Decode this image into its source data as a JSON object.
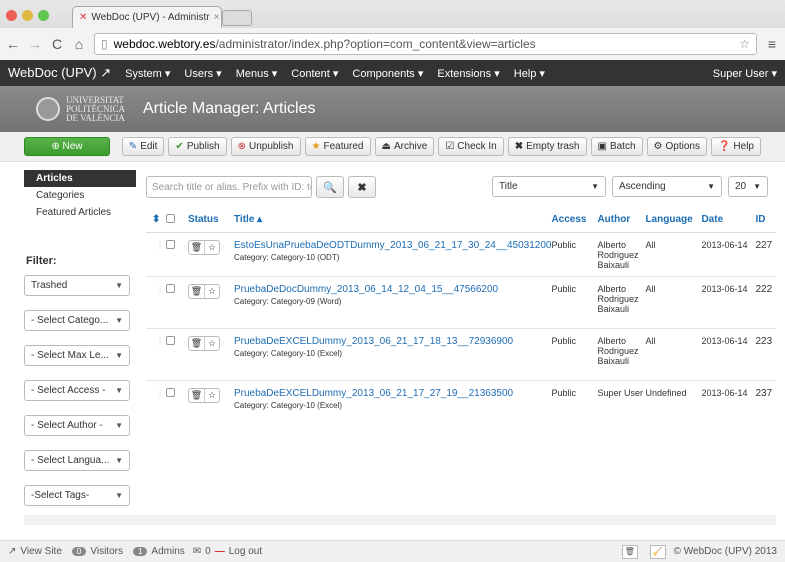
{
  "browser": {
    "tab_title": "WebDoc (UPV) - Administr",
    "url_host": "webdoc.webtory.es",
    "url_path": "/administrator/index.php?option=com_content&view=articles"
  },
  "menubar": {
    "brand": "WebDoc (UPV) ↗",
    "items": [
      "System ▾",
      "Users ▾",
      "Menus ▾",
      "Content ▾",
      "Components ▾",
      "Extensions ▾",
      "Help ▾"
    ],
    "user": "Super User ▾"
  },
  "header": {
    "logo_lines": [
      "UNIVERSITAT",
      "POLITÈCNICA",
      "DE VALÈNCIA"
    ],
    "title": "Article Manager: Articles"
  },
  "toolbar": {
    "new": "⊕ New",
    "edit": "Edit",
    "publish": "Publish",
    "unpublish": "Unpublish",
    "featured": "Featured",
    "archive": "Archive",
    "checkin": "Check In",
    "empty_trash": "Empty trash",
    "batch": "Batch",
    "options": "Options",
    "help": "Help"
  },
  "sidebar": {
    "items": [
      "Articles",
      "Categories",
      "Featured Articles"
    ],
    "filter_title": "Filter:",
    "filters": [
      "Trashed",
      "- Select Catego...",
      "- Select Max Le...",
      "- Select Access -",
      "- Select Author -",
      "- Select Langua...",
      "-Select Tags-"
    ]
  },
  "search": {
    "placeholder": "Search title or alias. Prefix with ID: to",
    "sort_field": "Title",
    "sort_dir": "Ascending",
    "limit": "20"
  },
  "table": {
    "headers": {
      "status": "Status",
      "title": "Title ▴",
      "access": "Access",
      "author": "Author",
      "language": "Language",
      "date": "Date",
      "id": "ID"
    },
    "rows": [
      {
        "title": "EstoEsUnaPruebaDeODTDummy_2013_06_21_17_30_24__45031200",
        "category": "Category: Category-10 (ODT)",
        "access": "Public",
        "author": "Alberto Rodriguez Baixauli",
        "language": "All",
        "date": "2013-06-14",
        "id": "227"
      },
      {
        "title": "PruebaDeDocDummy_2013_06_14_12_04_15__47566200",
        "category": "Category: Category-09 (Word)",
        "access": "Public",
        "author": "Alberto Rodriguez Baixauli",
        "language": "All",
        "date": "2013-06-14",
        "id": "222"
      },
      {
        "title": "PruebaDeEXCELDummy_2013_06_21_17_18_13__72936900",
        "category": "Category: Category-10 (Excel)",
        "access": "Public",
        "author": "Alberto Rodriguez Baixauli",
        "language": "All",
        "date": "2013-06-14",
        "id": "223"
      },
      {
        "title": "PruebaDeEXCELDummy_2013_06_21_17_27_19__21363500",
        "category": "Category: Category-10 (Excel)",
        "access": "Public",
        "author": "Super User",
        "language": "Undefined",
        "date": "2013-06-14",
        "id": "237"
      }
    ]
  },
  "footer": {
    "view_site": "View Site",
    "visitors_count": "0",
    "visitors": "Visitors",
    "admins_count": "1",
    "admins": "Admins",
    "messages": "0",
    "logout": "Log out",
    "copyright": "© WebDoc (UPV) 2013"
  }
}
